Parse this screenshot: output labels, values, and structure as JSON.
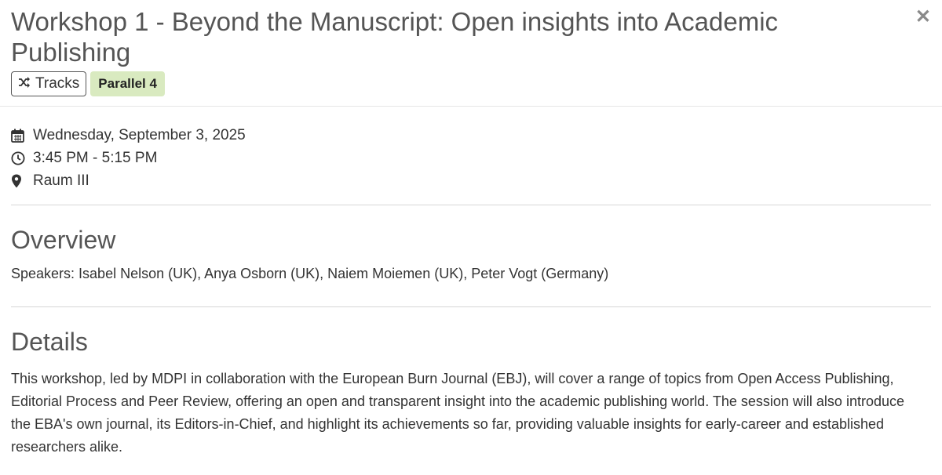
{
  "modal": {
    "title": "Workshop 1 - Beyond the Manuscript: Open insights into Academic Publishing",
    "close_icon": "close-icon"
  },
  "badges": {
    "tracks_label": "Tracks",
    "tracks_icon": "shuffle-icon",
    "parallel_label": "Parallel 4",
    "parallel_color": "#d9eac0"
  },
  "meta": {
    "date": "Wednesday, September 3, 2025",
    "date_icon": "calendar-icon",
    "time": "3:45 PM - 5:15 PM",
    "time_icon": "clock-icon",
    "location": "Raum III",
    "location_icon": "map-marker-icon"
  },
  "overview": {
    "heading": "Overview",
    "speakers": "Speakers: Isabel Nelson (UK), Anya Osborn (UK), Naiem Moiemen (UK), Peter Vogt (Germany)"
  },
  "details": {
    "heading": "Details",
    "body": "This workshop, led by MDPI in collaboration with the European Burn Journal (EBJ), will cover a range of topics from Open Access Publishing, Editorial Process and Peer Review, offering an open and transparent insight into the academic publishing world. The session will also introduce the EBA's own journal, its Editors-in-Chief, and highlight its achievements so far, providing valuable insights for early-career and established researchers alike."
  }
}
